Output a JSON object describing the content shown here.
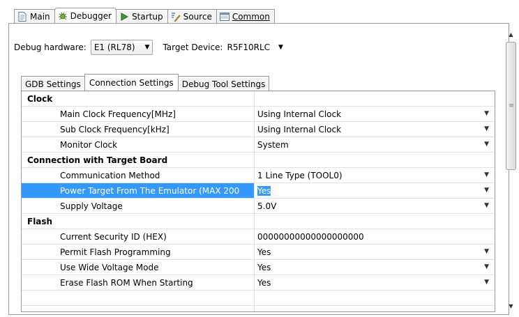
{
  "outer_tabs": [
    {
      "label": "Main",
      "icon": "page-icon"
    },
    {
      "label": "Debugger",
      "icon": "bug-icon"
    },
    {
      "label": "Startup",
      "icon": "play-icon"
    },
    {
      "label": "Source",
      "icon": "source-icon"
    },
    {
      "label": "Common",
      "icon": "common-icon"
    }
  ],
  "hardware": {
    "debug_hardware_label": "Debug hardware:",
    "debug_hardware_value": "E1 (RL78)",
    "target_device_label": "Target Device:",
    "target_device_value": "R5F10RLC"
  },
  "inner_tabs": [
    "GDB Settings",
    "Connection Settings",
    "Debug Tool Settings"
  ],
  "table": {
    "rows": [
      {
        "kind": "cat",
        "name": "Clock",
        "value": ""
      },
      {
        "kind": "prop",
        "name": "Main Clock Frequency[MHz]",
        "value": "Using Internal Clock",
        "dropdown": true
      },
      {
        "kind": "prop",
        "name": "Sub Clock Frequency[kHz]",
        "value": "Using Internal Clock",
        "dropdown": true
      },
      {
        "kind": "prop",
        "name": "Monitor Clock",
        "value": "System",
        "dropdown": true
      },
      {
        "kind": "cat",
        "name": "Connection with Target Board",
        "value": ""
      },
      {
        "kind": "prop",
        "name": "Communication Method",
        "value": "1 Line Type (TOOL0)",
        "dropdown": true
      },
      {
        "kind": "prop",
        "name": "Power Target From The Emulator (MAX 200",
        "value": "Yes",
        "dropdown": true,
        "selected": true
      },
      {
        "kind": "prop",
        "name": "Supply Voltage",
        "value": "5.0V",
        "dropdown": true
      },
      {
        "kind": "cat",
        "name": "Flash",
        "value": ""
      },
      {
        "kind": "prop",
        "name": "Current Security ID (HEX)",
        "value": "00000000000000000000",
        "dropdown": false
      },
      {
        "kind": "prop",
        "name": "Permit Flash Programming",
        "value": "Yes",
        "dropdown": true
      },
      {
        "kind": "prop",
        "name": "Use Wide Voltage Mode",
        "value": "Yes",
        "dropdown": true
      },
      {
        "kind": "prop",
        "name": "Erase Flash ROM When Starting",
        "value": "Yes",
        "dropdown": true
      },
      {
        "kind": "empty",
        "name": "",
        "value": ""
      },
      {
        "kind": "empty",
        "name": "",
        "value": ""
      }
    ]
  },
  "colors": {
    "selection": "#3399ff",
    "border": "#9a9a9a"
  }
}
